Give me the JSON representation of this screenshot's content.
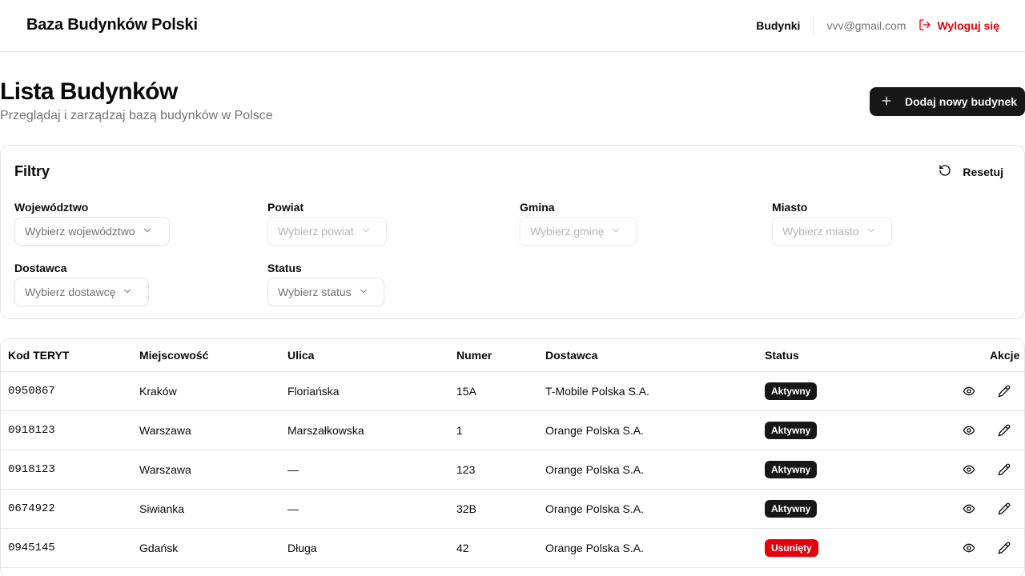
{
  "header": {
    "brand": "Baza Budynków Polski",
    "nav_buildings": "Budynki",
    "user_email": "vvv@gmail.com",
    "logout_label": "Wyloguj się"
  },
  "page": {
    "title": "Lista Budynków",
    "subtitle": "Przeglądaj i zarządzaj bazą budynków w Polsce",
    "add_button_label": "Dodaj nowy budynek"
  },
  "filters": {
    "title": "Filtry",
    "reset_label": "Resetuj",
    "fields": [
      {
        "label": "Województwo",
        "placeholder": "Wybierz województwo",
        "disabled": false
      },
      {
        "label": "Powiat",
        "placeholder": "Wybierz powiat",
        "disabled": true
      },
      {
        "label": "Gmina",
        "placeholder": "Wybierz gminę",
        "disabled": true
      },
      {
        "label": "Miasto",
        "placeholder": "Wybierz miasto",
        "disabled": true
      },
      {
        "label": "Dostawca",
        "placeholder": "Wybierz dostawcę",
        "disabled": false
      },
      {
        "label": "Status",
        "placeholder": "Wybierz status",
        "disabled": false
      }
    ]
  },
  "table": {
    "columns": [
      "Kod TERYT",
      "Miejscowość",
      "Ulica",
      "Numer",
      "Dostawca",
      "Status",
      "Akcje"
    ],
    "rows": [
      {
        "teryt": "0950867",
        "city": "Kraków",
        "street": "Floriańska",
        "number": "15A",
        "provider": "T-Mobile Polska S.A.",
        "status": "Aktywny",
        "status_color": "#171717"
      },
      {
        "teryt": "0918123",
        "city": "Warszawa",
        "street": "Marszałkowska",
        "number": "1",
        "provider": "Orange Polska S.A.",
        "status": "Aktywny",
        "status_color": "#171717"
      },
      {
        "teryt": "0918123",
        "city": "Warszawa",
        "street": "—",
        "number": "123",
        "provider": "Orange Polska S.A.",
        "status": "Aktywny",
        "status_color": "#171717"
      },
      {
        "teryt": "0674922",
        "city": "Siwianka",
        "street": "—",
        "number": "32B",
        "provider": "Orange Polska S.A.",
        "status": "Aktywny",
        "status_color": "#171717"
      },
      {
        "teryt": "0945145",
        "city": "Gdańsk",
        "street": "Długa",
        "number": "42",
        "provider": "Orange Polska S.A.",
        "status": "Usunięty",
        "status_color": "#e7000b"
      }
    ]
  },
  "colors": {
    "accent": "#171717",
    "danger": "#e7000b",
    "muted": "#737373",
    "border": "#e5e5e5"
  }
}
